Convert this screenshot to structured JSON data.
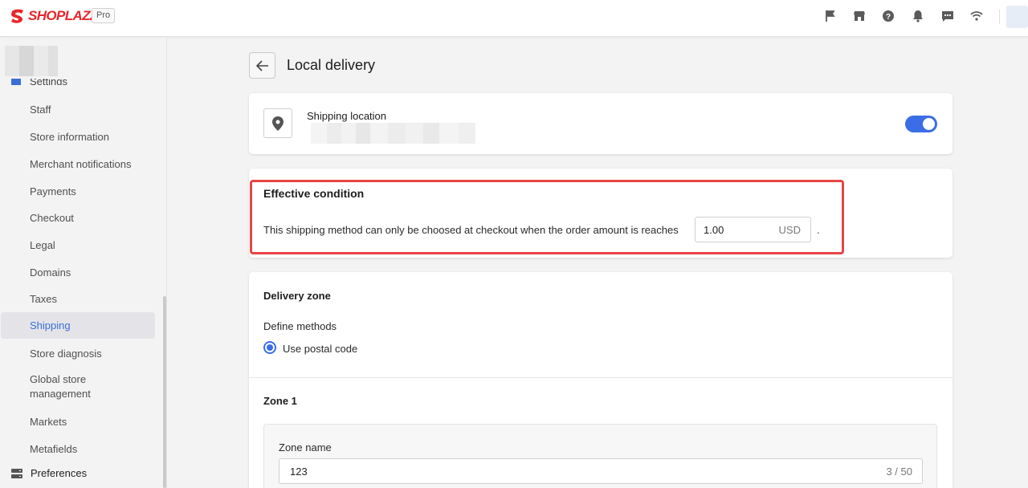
{
  "app": {
    "brand": "SHOPLAZZA",
    "plan_badge": "Pro",
    "brand_color": "#e8262a",
    "accent_color": "#3b6ee6"
  },
  "topbar_icons": [
    "flag-icon",
    "store-icon",
    "help-icon",
    "bell-icon",
    "chat-icon",
    "wifi-icon"
  ],
  "sidebar": {
    "section": "Settings",
    "items": [
      {
        "label": "Staff"
      },
      {
        "label": "Store information"
      },
      {
        "label": "Merchant notifications"
      },
      {
        "label": "Payments"
      },
      {
        "label": "Checkout"
      },
      {
        "label": "Legal"
      },
      {
        "label": "Domains"
      },
      {
        "label": "Taxes"
      },
      {
        "label": "Shipping",
        "active": true
      },
      {
        "label": "Store diagnosis"
      },
      {
        "label": "Global store\nmanagement"
      },
      {
        "label": "Markets"
      },
      {
        "label": "Metafields"
      }
    ],
    "preferences": "Preferences"
  },
  "page": {
    "title": "Local delivery"
  },
  "shipping_location": {
    "title": "Shipping location",
    "enabled": true
  },
  "effective_condition": {
    "title": "Effective condition",
    "text": "This shipping method can only be choosed at checkout when the order amount is reaches",
    "amount": "1.00",
    "currency": "USD",
    "suffix": "."
  },
  "delivery_zone": {
    "title": "Delivery zone",
    "define_label": "Define methods",
    "method": "Use postal code",
    "zone_title": "Zone 1",
    "zone_name_label": "Zone name",
    "zone_name_value": "123",
    "char_count": "3 / 50"
  }
}
